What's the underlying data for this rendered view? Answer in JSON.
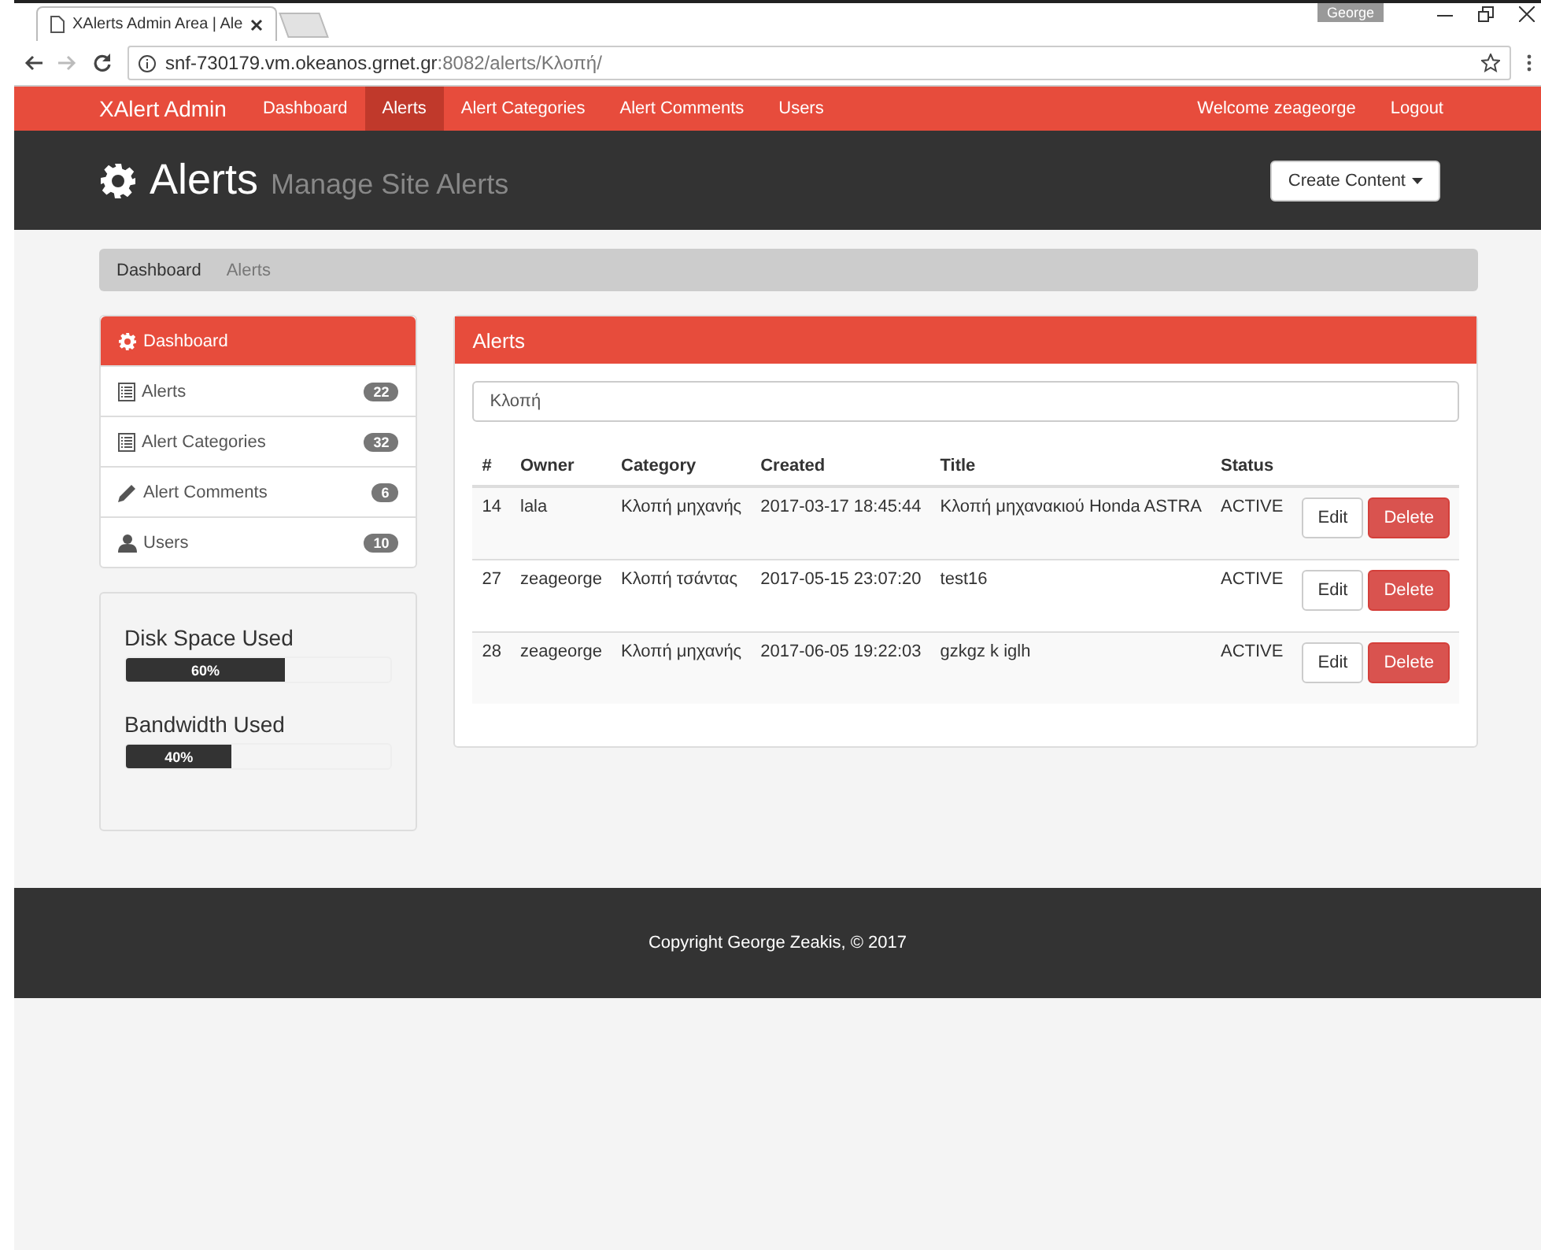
{
  "browser": {
    "tab_title": "XAlerts Admin Area | Ale",
    "url_host": "snf-730179.vm.okeanos.grnet.gr",
    "url_path": ":8082/alerts/Κλοπή/",
    "profile": "George"
  },
  "navbar": {
    "brand": "XAlert Admin",
    "items": [
      {
        "label": "Dashboard",
        "selected": false
      },
      {
        "label": "Alerts",
        "selected": true
      },
      {
        "label": "Alert Categories",
        "selected": false
      },
      {
        "label": "Alert Comments",
        "selected": false
      },
      {
        "label": "Users",
        "selected": false
      }
    ],
    "right": [
      "Welcome zeageorge",
      "Logout"
    ]
  },
  "header": {
    "title": "Alerts",
    "subtitle": "Manage Site Alerts",
    "button": "Create Content"
  },
  "breadcrumb": [
    "Dashboard",
    "Alerts"
  ],
  "sidebar": {
    "items": [
      {
        "label": "Dashboard",
        "kind": "gear",
        "selected": true
      },
      {
        "label": "Alerts",
        "kind": "list",
        "count": "22",
        "selected": false
      },
      {
        "label": "Alert Categories",
        "kind": "list",
        "count": "32",
        "selected": false
      },
      {
        "label": "Alert Comments",
        "kind": "pencil",
        "count": "6",
        "selected": false
      },
      {
        "label": "Users",
        "kind": "user",
        "count": "10",
        "selected": false
      }
    ]
  },
  "usage": [
    {
      "label": "Disk Space Used",
      "level": 0.6,
      "reading": "60%"
    },
    {
      "label": "Bandwidth Used",
      "level": 0.4,
      "reading": "40%"
    }
  ],
  "panel": {
    "title": "Alerts",
    "search": "Κλοπή",
    "columns": [
      "#",
      "Owner",
      "Category",
      "Created",
      "Title",
      "Status"
    ],
    "rows": [
      {
        "cells": [
          "14",
          "lala",
          "Κλοπή μηχανής",
          "2017-03-17 18:45:44",
          "Κλοπή μηχανακιού Honda ASTRA",
          "ACTIVE"
        ],
        "actions": [
          "Edit",
          "Delete"
        ]
      },
      {
        "cells": [
          "27",
          "zeageorge",
          "Κλοπή τσάντας",
          "2017-05-15 23:07:20",
          "test16",
          "ACTIVE"
        ],
        "actions": [
          "Edit",
          "Delete"
        ]
      },
      {
        "cells": [
          "28",
          "zeageorge",
          "Κλοπή μηχανής",
          "2017-06-05 19:22:03",
          "gzkgz k iglh",
          "ACTIVE"
        ],
        "actions": [
          "Edit",
          "Delete"
        ]
      }
    ]
  },
  "footer": "Copyright George Zeakis, © 2017"
}
